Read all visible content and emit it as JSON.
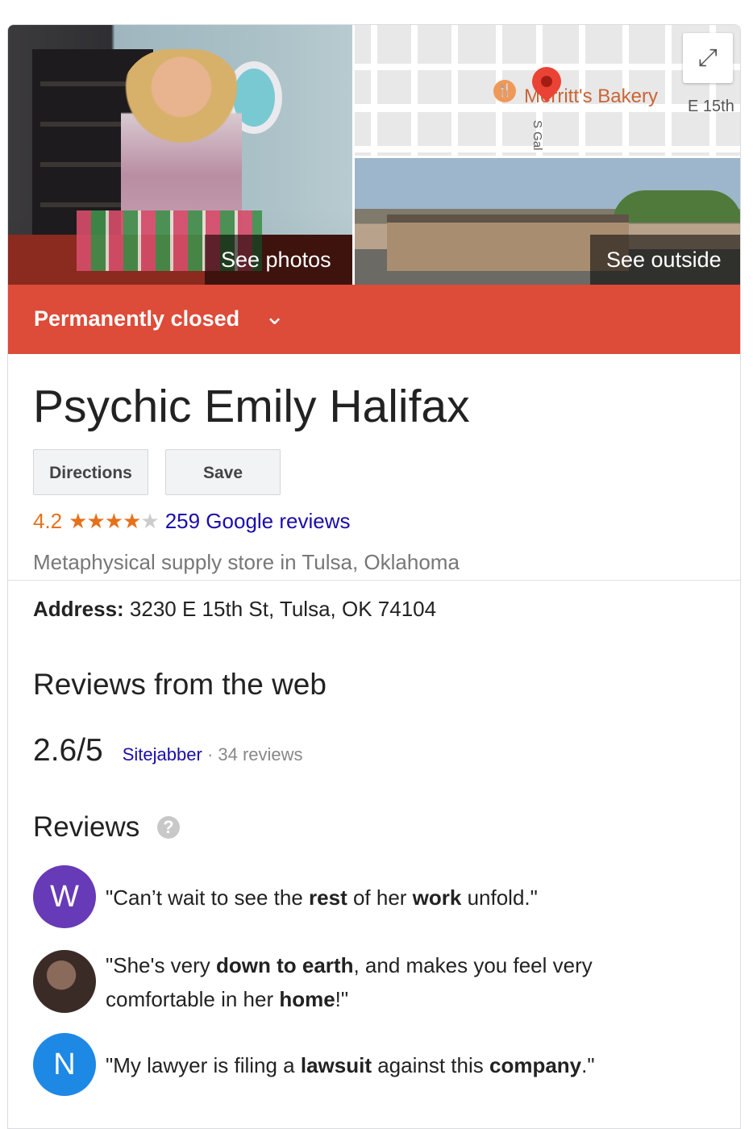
{
  "media": {
    "photos_label": "See photos",
    "outside_label": "See outside",
    "map": {
      "bakery_label": "Merritt's Bakery",
      "street_label_1": "E 15th",
      "street_label_2": "S Gal"
    },
    "expand_icon": "expand-icon"
  },
  "status": {
    "label": "Permanently closed",
    "color": "#dd4b39"
  },
  "business": {
    "name": "Psychic Emily Halifax",
    "category": "Metaphysical supply store in Tulsa, Oklahoma",
    "address_label": "Address:",
    "address_value": " 3230 E 15th St, Tulsa, OK 74104"
  },
  "actions": {
    "directions": "Directions",
    "save": "Save"
  },
  "rating": {
    "value": "4.2",
    "stars": 4.2,
    "reviews_link": "259 Google reviews"
  },
  "web_reviews": {
    "heading": "Reviews from the web",
    "score": "2.6/5",
    "source": "Sitejabber",
    "count": " · 34 reviews"
  },
  "reviews": {
    "heading": "Reviews",
    "items": [
      {
        "avatar_letter": "W",
        "avatar_color": "#673ab7",
        "parts": [
          [
            "\"Can’t wait to see the ",
            false
          ],
          [
            "rest",
            true
          ],
          [
            " of her ",
            false
          ],
          [
            "work",
            true
          ],
          [
            " unfold.\"",
            false
          ]
        ]
      },
      {
        "avatar_letter": "",
        "avatar_color": "#5a4a45",
        "parts": [
          [
            "\"She's very ",
            false
          ],
          [
            "down to earth",
            true
          ],
          [
            ", and makes you feel very comfortable in her ",
            false
          ],
          [
            "home",
            true
          ],
          [
            "!\"",
            false
          ]
        ]
      },
      {
        "avatar_letter": "N",
        "avatar_color": "#1e88e5",
        "parts": [
          [
            "\"My lawyer is filing a ",
            false
          ],
          [
            "lawsuit",
            true
          ],
          [
            " against this ",
            false
          ],
          [
            "company",
            true
          ],
          [
            ".\"",
            false
          ]
        ]
      }
    ]
  }
}
